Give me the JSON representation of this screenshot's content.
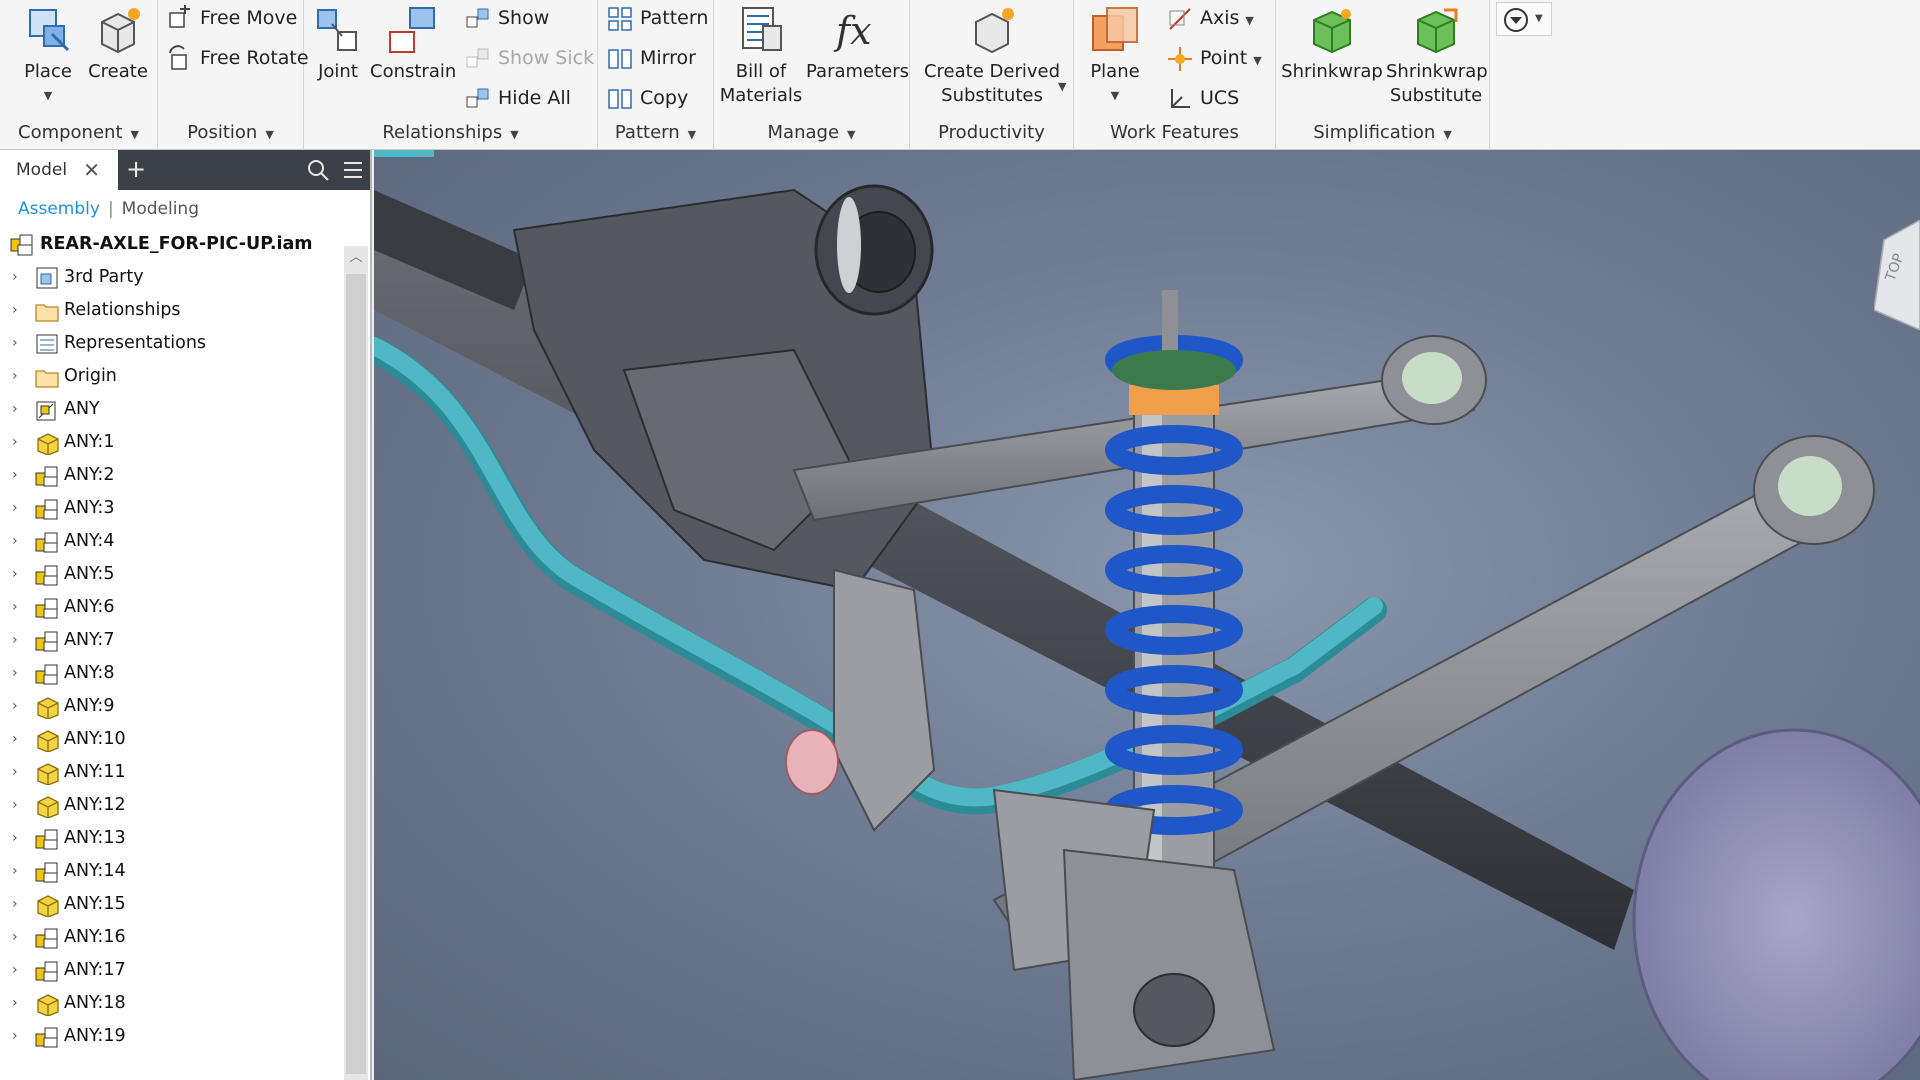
{
  "ribbon": {
    "component": {
      "title": "Component",
      "place": "Place",
      "create": "Create"
    },
    "position": {
      "title": "Position",
      "free_move": "Free Move",
      "free_rotate": "Free Rotate"
    },
    "relationships": {
      "title": "Relationships",
      "joint": "Joint",
      "constrain": "Constrain",
      "show": "Show",
      "show_sick": "Show Sick",
      "hide_all": "Hide All"
    },
    "pattern": {
      "title": "Pattern",
      "pattern": "Pattern",
      "mirror": "Mirror",
      "copy": "Copy"
    },
    "manage": {
      "title": "Manage",
      "bom_line1": "Bill of",
      "bom_line2": "Materials",
      "parameters": "Parameters"
    },
    "productivity": {
      "title": "Productivity",
      "cds_line1": "Create Derived",
      "cds_line2": "Substitutes"
    },
    "work_features": {
      "title": "Work Features",
      "plane": "Plane",
      "axis": "Axis",
      "point": "Point",
      "ucs": "UCS"
    },
    "simplification": {
      "title": "Simplification",
      "shrinkwrap": "Shrinkwrap",
      "shrinkwrap_sub_line1": "Shrinkwrap",
      "shrinkwrap_sub_line2": "Substitute"
    }
  },
  "browser": {
    "tab_label": "Model",
    "mode_assembly": "Assembly",
    "mode_modeling": "Modeling",
    "root": "REAR-AXLE_FOR-PIC-UP.iam",
    "items": [
      {
        "label": "3rd Party",
        "icon": "third-party-icon"
      },
      {
        "label": "Relationships",
        "icon": "folder-icon"
      },
      {
        "label": "Representations",
        "icon": "representations-icon"
      },
      {
        "label": "Origin",
        "icon": "folder-icon"
      },
      {
        "label": "ANY",
        "icon": "assembly-icon"
      },
      {
        "label": "ANY:1",
        "icon": "part-icon"
      },
      {
        "label": "ANY:2",
        "icon": "subassembly-icon"
      },
      {
        "label": "ANY:3",
        "icon": "subassembly-icon"
      },
      {
        "label": "ANY:4",
        "icon": "subassembly-icon"
      },
      {
        "label": "ANY:5",
        "icon": "subassembly-icon"
      },
      {
        "label": "ANY:6",
        "icon": "subassembly-icon"
      },
      {
        "label": "ANY:7",
        "icon": "subassembly-icon"
      },
      {
        "label": "ANY:8",
        "icon": "subassembly-icon"
      },
      {
        "label": "ANY:9",
        "icon": "part-icon"
      },
      {
        "label": "ANY:10",
        "icon": "part-icon"
      },
      {
        "label": "ANY:11",
        "icon": "part-icon"
      },
      {
        "label": "ANY:12",
        "icon": "part-icon"
      },
      {
        "label": "ANY:13",
        "icon": "subassembly-icon"
      },
      {
        "label": "ANY:14",
        "icon": "subassembly-icon"
      },
      {
        "label": "ANY:15",
        "icon": "part-icon"
      },
      {
        "label": "ANY:16",
        "icon": "subassembly-icon"
      },
      {
        "label": "ANY:17",
        "icon": "subassembly-icon"
      },
      {
        "label": "ANY:18",
        "icon": "part-icon"
      },
      {
        "label": "ANY:19",
        "icon": "subassembly-icon"
      }
    ]
  },
  "colors": {
    "accent": "#1f8fd6",
    "viewport_bg": "#6f7c93",
    "spring": "#1f57c8",
    "sway_bar": "#4fb8c4",
    "axle": "#4a4d54"
  }
}
